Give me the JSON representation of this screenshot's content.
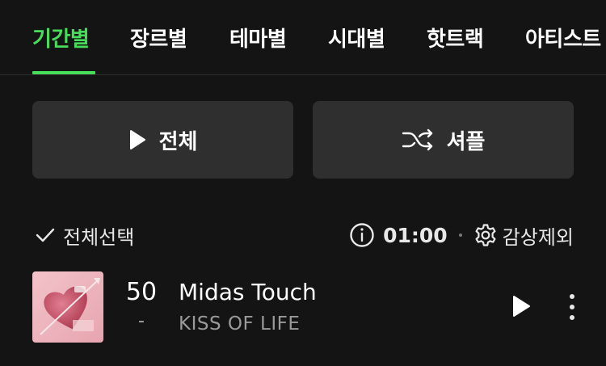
{
  "tabs": [
    {
      "label": "기간별",
      "active": true
    },
    {
      "label": "장르별",
      "active": false
    },
    {
      "label": "테마별",
      "active": false
    },
    {
      "label": "시대별",
      "active": false
    },
    {
      "label": "핫트랙",
      "active": false
    },
    {
      "label": "아티스트",
      "active": false
    }
  ],
  "buttons": {
    "play_all": {
      "label": "전체",
      "icon": "play-icon"
    },
    "shuffle": {
      "label": "셔플",
      "icon": "shuffle-icon"
    }
  },
  "controls": {
    "select_all_label": "전체선택",
    "timer_value": "01:00",
    "exclude_label": "감상제외"
  },
  "songs": [
    {
      "rank": "50",
      "change": "-",
      "title": "Midas Touch",
      "artist": "KISS OF LIFE"
    }
  ],
  "colors": {
    "accent": "#47dd5a",
    "background": "#141414",
    "button_bg": "#2f2f2f",
    "secondary_text": "#9a9a9a"
  }
}
